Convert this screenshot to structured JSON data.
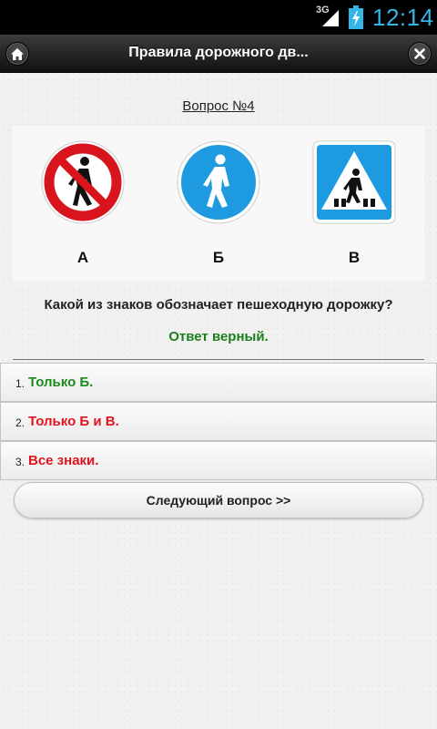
{
  "status_bar": {
    "network": "3G",
    "time": "12:14"
  },
  "header": {
    "title": "Правила дорожного дв...",
    "home_icon": "home-icon",
    "close_icon": "close-icon"
  },
  "question": {
    "label": "Вопрос №4",
    "signs": [
      {
        "letter": "А",
        "icon": "no-pedestrians-sign-icon"
      },
      {
        "letter": "Б",
        "icon": "pedestrian-path-sign-icon"
      },
      {
        "letter": "В",
        "icon": "pedestrian-crossing-sign-icon"
      }
    ],
    "text": "Какой из знаков обозначает пешеходную дорожку?",
    "result": "Ответ верный."
  },
  "answers": [
    {
      "number": "1.",
      "text": "Только Б.",
      "status": "correct"
    },
    {
      "number": "2.",
      "text": "Только Б и В.",
      "status": "wrong"
    },
    {
      "number": "3.",
      "text": "Все знаки.",
      "status": "wrong"
    }
  ],
  "next_button": {
    "label": "Следующий вопрос >>"
  },
  "colors": {
    "correct": "#1a8a1a",
    "wrong": "#e0141e",
    "accent": "#33b5e5"
  }
}
